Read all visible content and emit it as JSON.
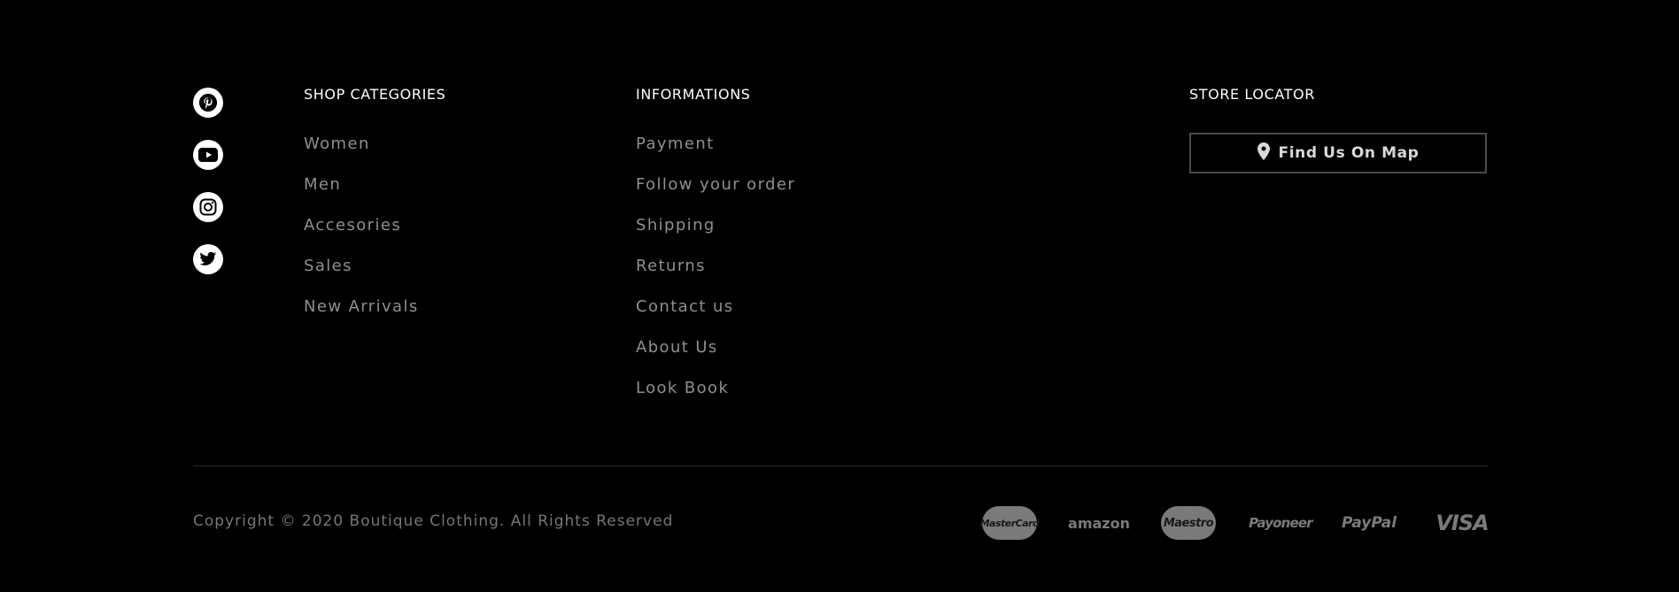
{
  "social": [
    {
      "icon": "pinterest-icon"
    },
    {
      "icon": "youtube-icon"
    },
    {
      "icon": "instagram-icon"
    },
    {
      "icon": "twitter-icon"
    }
  ],
  "shop": {
    "title": "SHOP CATEGORIES",
    "items": [
      "Women",
      "Men",
      "Accesories",
      "Sales",
      "New Arrivals"
    ]
  },
  "info": {
    "title": "INFORMATIONS",
    "items": [
      "Payment",
      "Follow your order",
      "Shipping",
      "Returns",
      "Contact us",
      "About Us",
      "Look Book"
    ]
  },
  "store": {
    "title": "STORE LOCATOR",
    "button_label": "Find Us On Map",
    "button_icon": "map-pin-icon"
  },
  "footer": {
    "copyright": "Copyright © 2020 Boutique Clothing. All Rights Reserved"
  },
  "payments": [
    {
      "name": "MasterCard",
      "icon": "mastercard-icon"
    },
    {
      "name": "amazon",
      "icon": "amazon-icon"
    },
    {
      "name": "Maestro",
      "icon": "maestro-icon"
    },
    {
      "name": "Payoneer",
      "icon": "payoneer-icon"
    },
    {
      "name": "PayPal",
      "icon": "paypal-icon"
    },
    {
      "name": "VISA",
      "icon": "visa-icon"
    }
  ],
  "colors": {
    "background": "#000000",
    "link_text": "#8f8f8f",
    "copyright_text": "#767676",
    "button_border": "#4a4a4a"
  }
}
